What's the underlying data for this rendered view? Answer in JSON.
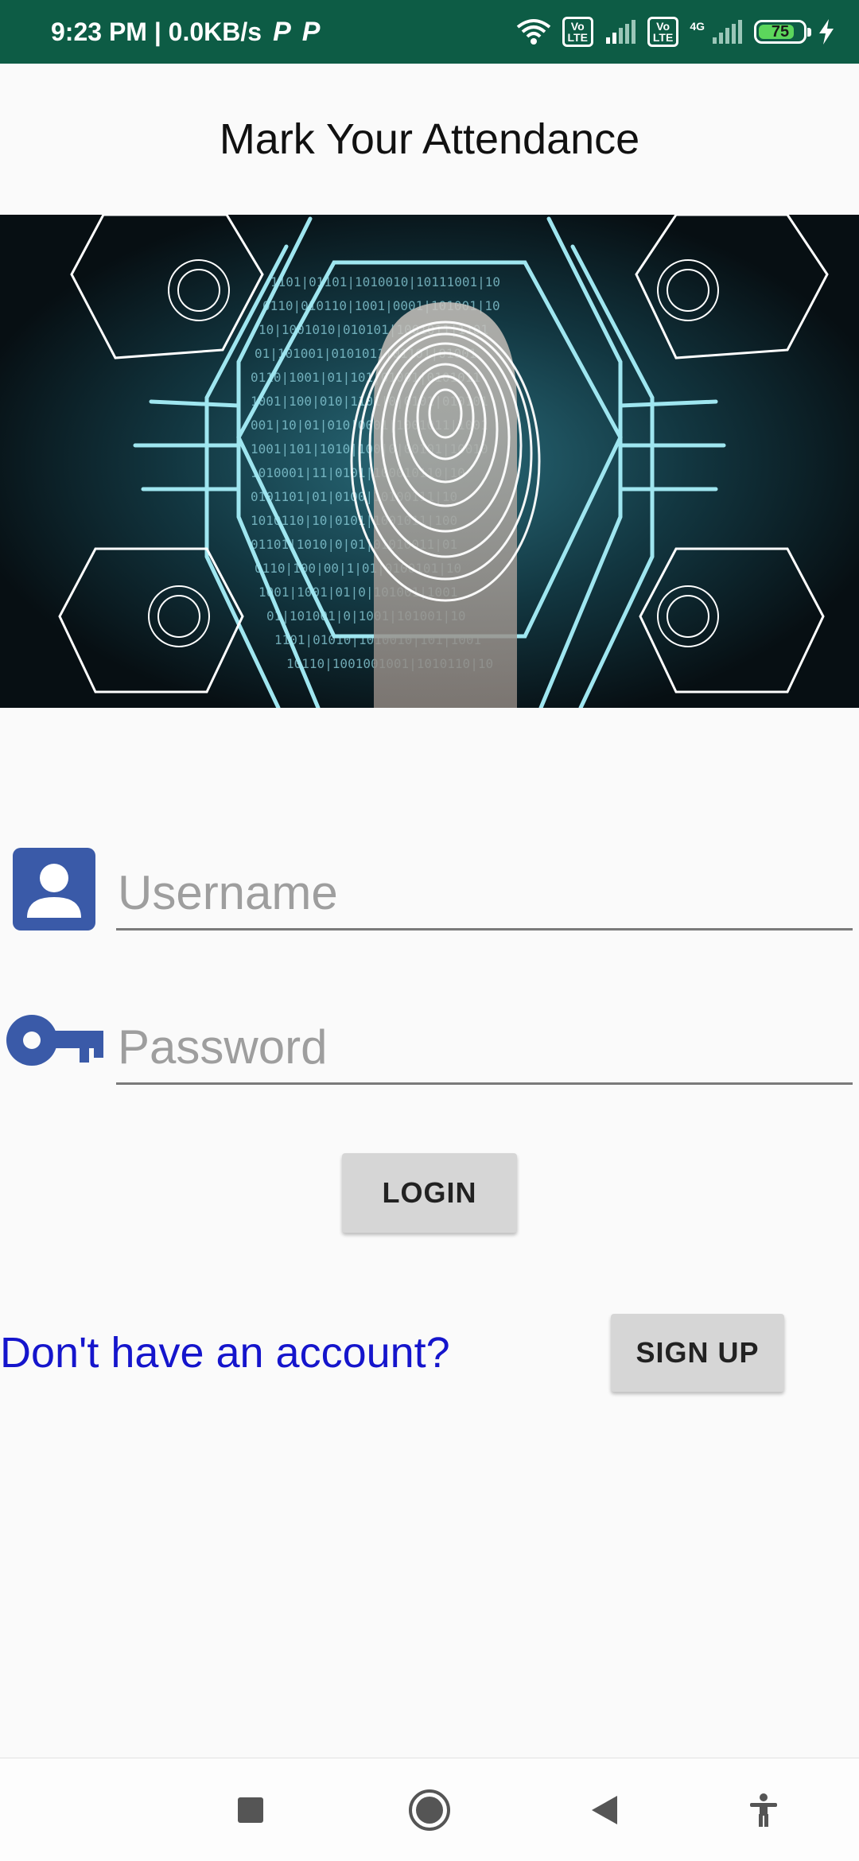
{
  "status_bar": {
    "time": "9:23 PM | 0.0KB/s",
    "notification_icons": [
      "p-icon",
      "p-icon"
    ],
    "volte_label": "Vo\nLTE",
    "network_type": "4G",
    "battery_level": "75",
    "background_color": "#0d5c45"
  },
  "header": {
    "title": "Mark Your Attendance"
  },
  "banner": {
    "description_icon": "fingerprint-image",
    "accent_color": "#36c6d8"
  },
  "form": {
    "username": {
      "placeholder": "Username",
      "value": "",
      "icon": "person-icon"
    },
    "password": {
      "placeholder": "Password",
      "value": "",
      "icon": "key-icon"
    },
    "icon_color": "#3a5aa8",
    "login_label": "LOGIN",
    "no_account_text": "Don't have an account?",
    "signup_label": "SIGN UP"
  },
  "nav_bar": {
    "items": [
      "recents-icon",
      "home-icon",
      "back-icon",
      "accessibility-icon"
    ]
  }
}
